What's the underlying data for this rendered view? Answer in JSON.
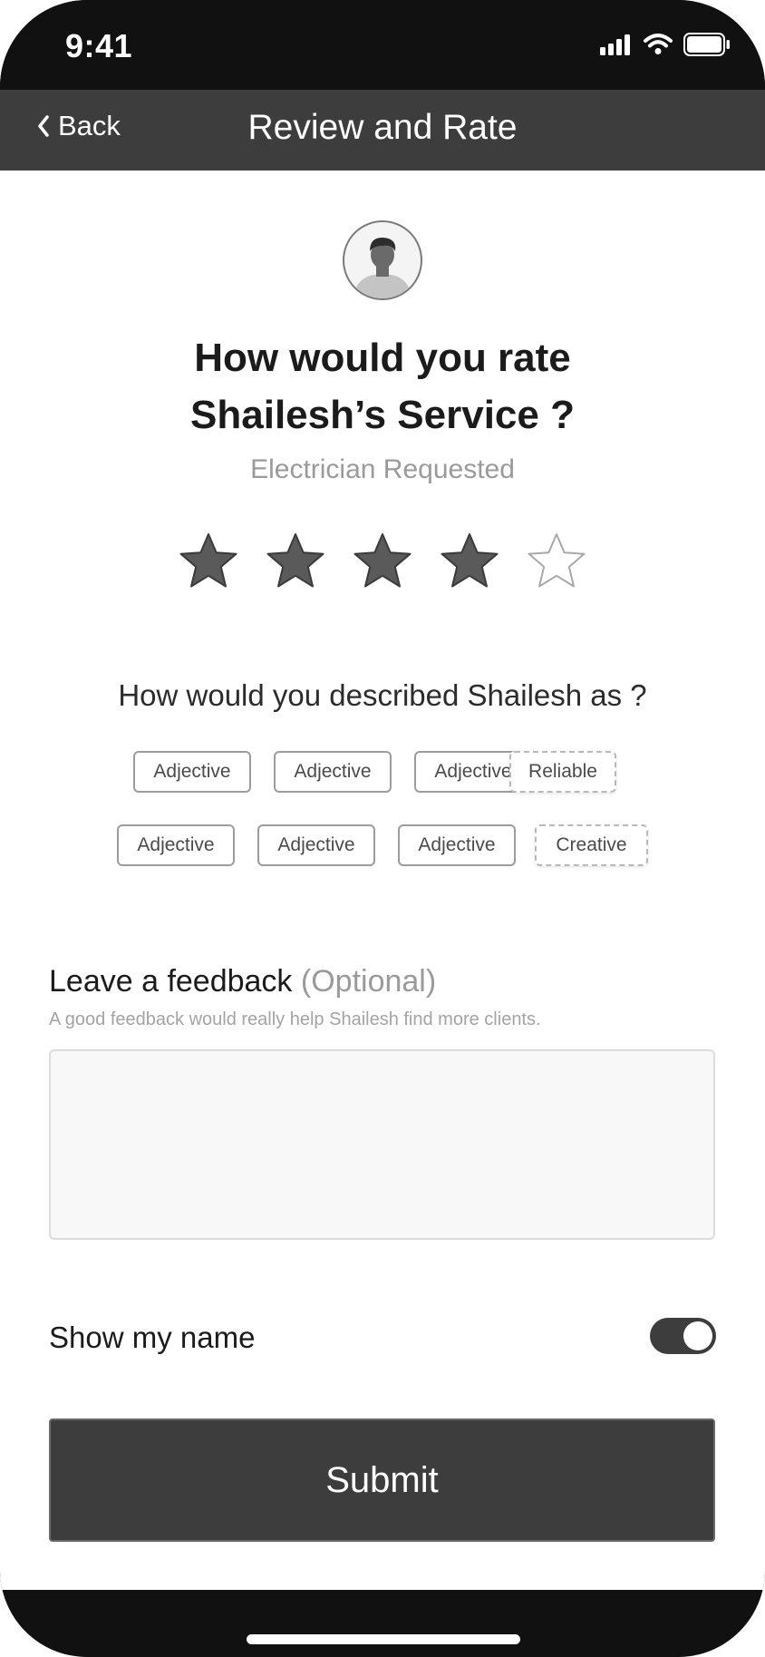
{
  "status_bar": {
    "time": "9:41",
    "icons": [
      "signal-icon",
      "wifi-icon",
      "battery-icon"
    ]
  },
  "nav": {
    "back_label": "Back",
    "title": "Review and Rate"
  },
  "profile": {
    "avatar_icon": "user-avatar-icon",
    "question_line1": "How would you rate",
    "question_line2": "Shailesh’s Service ?",
    "subtitle": "Electrician Requested"
  },
  "rating": {
    "value": 4,
    "max": 5,
    "filled_color": "#5a5a5a",
    "empty_color": "#ffffff"
  },
  "describe": {
    "question": "How would you described Shailesh as ?",
    "row1": [
      "Adjective",
      "Adjective",
      "Adjective",
      "Reliable"
    ],
    "row2": [
      "Adjective",
      "Adjective",
      "Adjective",
      "Creative"
    ]
  },
  "feedback": {
    "title": "Leave a feedback",
    "optional": "(Optional)",
    "hint": "A good feedback would really help Shailesh find more clients.",
    "value": "",
    "placeholder": ""
  },
  "show_name": {
    "label": "Show my name",
    "enabled": true
  },
  "submit_label": "Submit",
  "colors": {
    "dark": "#3d3d3d",
    "frame": "#111111"
  }
}
